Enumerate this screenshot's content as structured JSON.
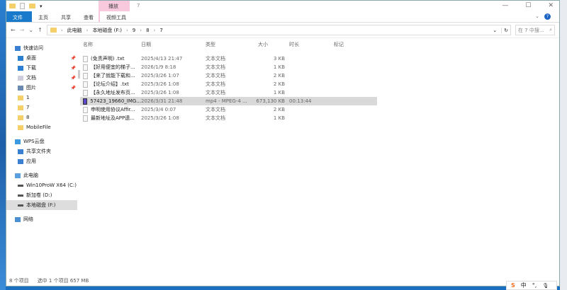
{
  "window": {
    "title": "7",
    "context_tab_group": "播放",
    "minimize": "—",
    "maximize": "☐",
    "close": "✕"
  },
  "ribbon": {
    "tabs": [
      "文件",
      "主页",
      "共享",
      "查看",
      "视频工具"
    ],
    "expand": "⌄",
    "help": "?"
  },
  "address": {
    "back": "←",
    "forward": "→",
    "recent": "⌄",
    "up": "↑",
    "path": [
      "此电脑",
      "本地磁盘 (F:)",
      "9",
      "8",
      "7"
    ],
    "dropdown": "⌄",
    "refresh": "↻",
    "search_placeholder": "在 7 中搜...",
    "search_icon": "⌕"
  },
  "sidebar": {
    "items": [
      {
        "label": "快速访问",
        "icon": "star-icon",
        "level": 0
      },
      {
        "label": "桌面",
        "icon": "desktop-icon",
        "pinned": true
      },
      {
        "label": "下载",
        "icon": "download-icon",
        "pinned": true
      },
      {
        "label": "文档",
        "icon": "document-icon",
        "pinned": true
      },
      {
        "label": "图片",
        "icon": "pictures-icon",
        "pinned": true
      },
      {
        "label": "1",
        "icon": "folder-icon"
      },
      {
        "label": "7",
        "icon": "folder-icon"
      },
      {
        "label": "8",
        "icon": "folder-icon"
      },
      {
        "label": "MobileFile",
        "icon": "folder-icon"
      },
      {
        "label": "WPS云盘",
        "icon": "cloud-icon",
        "level": 0
      },
      {
        "label": "共享文件夹",
        "icon": "share-icon"
      },
      {
        "label": "应用",
        "icon": "apps-icon"
      },
      {
        "label": "此电脑",
        "icon": "computer-icon",
        "level": 0
      },
      {
        "label": "Win10ProW X64 (C:)",
        "icon": "drive-icon"
      },
      {
        "label": "新加卷 (D:)",
        "icon": "drive-icon"
      },
      {
        "label": "本地磁盘 (F:)",
        "icon": "drive-icon",
        "selected": true
      },
      {
        "label": "网络",
        "icon": "network-icon",
        "level": 0
      }
    ],
    "pin": "📌"
  },
  "columns": [
    "名称",
    "日期",
    "类型",
    "大小",
    "时长",
    "标记"
  ],
  "files": [
    {
      "name": "(免责声明) .txt",
      "date": "2025/4/13 21:47",
      "type": "文本文档",
      "size": "3 KB",
      "duration": ""
    },
    {
      "name": "【好用便宜的梯子...",
      "date": "2026/1/9 8:18",
      "type": "文本文档",
      "size": "1 KB",
      "duration": ""
    },
    {
      "name": "【来了就能下载和...",
      "date": "2025/3/26 1:07",
      "type": "文本文档",
      "size": "2 KB",
      "duration": ""
    },
    {
      "name": "【论坛介绍】.txt",
      "date": "2025/3/26 1:08",
      "type": "文本文档",
      "size": "2 KB",
      "duration": ""
    },
    {
      "name": "【永久地址发布页...",
      "date": "2025/3/26 1:08",
      "type": "文本文档",
      "size": "1 KB",
      "duration": ""
    },
    {
      "name": "57423_19660_IMG...",
      "date": "2026/3/31 21:48",
      "type": "mp4 - MPEG-4 ...",
      "size": "673,130 KB",
      "duration": "00:13:44",
      "selected": true,
      "video": true
    },
    {
      "name": "申明使用协议Affir...",
      "date": "2025/3/4 0:07",
      "type": "文本文档",
      "size": "2 KB",
      "duration": ""
    },
    {
      "name": "最新地址及APP遗...",
      "date": "2025/3/26 1:08",
      "type": "文本文档",
      "size": "1 KB",
      "duration": ""
    }
  ],
  "status": {
    "count": "8 个项目",
    "selection": "选中 1 个项目  657 MB"
  },
  "ime": {
    "logo": "S",
    "mode": "中",
    "punct": "°,",
    "mic": "🎙"
  }
}
